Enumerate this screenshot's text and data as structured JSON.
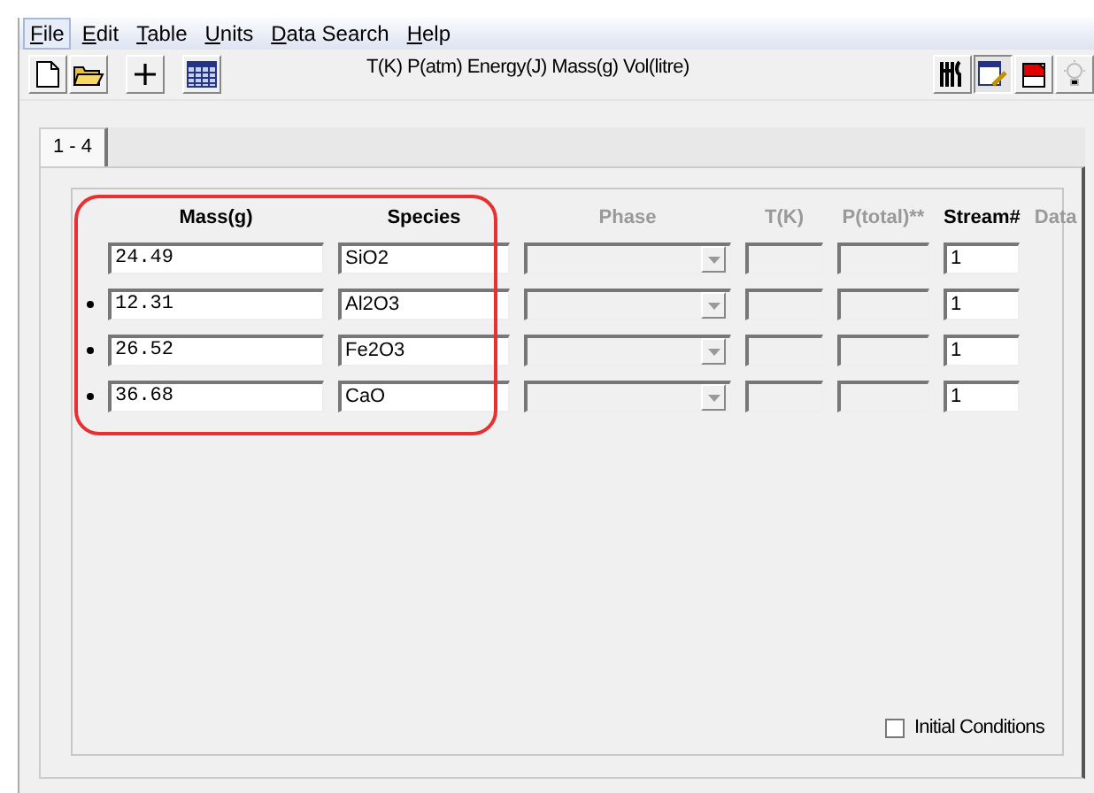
{
  "menu": [
    {
      "label": "File",
      "selected": true
    },
    {
      "label": "Edit",
      "selected": false
    },
    {
      "label": "Table",
      "selected": false
    },
    {
      "label": "Units",
      "selected": false
    },
    {
      "label": "Data Search",
      "selected": false
    },
    {
      "label": "Help",
      "selected": false
    }
  ],
  "units_text": "T(K) P(atm) Energy(J) Mass(g) Vol(litre)",
  "tabs": [
    {
      "label": "1 - 4",
      "selected": true
    }
  ],
  "columns": [
    {
      "label": "Mass(g)",
      "disabled": false,
      "kind": "number"
    },
    {
      "label": "Species",
      "disabled": false,
      "kind": "text"
    },
    {
      "label": "Phase",
      "disabled": true,
      "kind": "combo"
    },
    {
      "label": "T(K)",
      "disabled": true,
      "kind": "text"
    },
    {
      "label": "P(total)**",
      "disabled": true,
      "kind": "text"
    },
    {
      "label": "Stream#",
      "disabled": false,
      "kind": "text"
    }
  ],
  "extra_header": {
    "label": "Data",
    "disabled": true
  },
  "rows": [
    {
      "marked": false,
      "cells": [
        {
          "text": "24.49"
        },
        {
          "text": "SiO2"
        },
        {},
        {},
        {},
        {
          "text": "1"
        }
      ]
    },
    {
      "marked": true,
      "cells": [
        {
          "text": "12.31"
        },
        {
          "text": "Al2O3"
        },
        {},
        {},
        {},
        {
          "text": "1"
        }
      ]
    },
    {
      "marked": true,
      "cells": [
        {
          "text": "26.52"
        },
        {
          "text": "Fe2O3"
        },
        {},
        {},
        {},
        {
          "text": "1"
        }
      ]
    },
    {
      "marked": true,
      "cells": [
        {
          "text": "36.68"
        },
        {
          "text": "CaO"
        },
        {},
        {},
        {},
        {
          "text": "1"
        }
      ]
    }
  ],
  "initial_conditions": {
    "label": "Initial Conditions",
    "checked": false
  }
}
